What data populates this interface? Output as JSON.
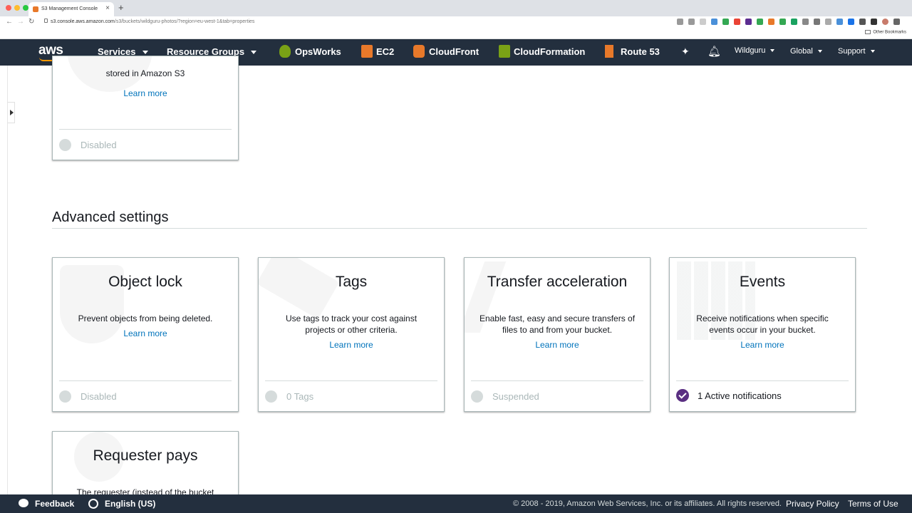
{
  "browser": {
    "tab_title": "S3 Management Console",
    "tab_close": "×",
    "new_tab": "+",
    "url_host": "s3.console.aws.amazon.com",
    "url_path": "/s3/buckets/wildguru-photos/?region=eu-west-1&tab=properties",
    "other_bookmarks": "Other Bookmarks"
  },
  "aws_nav": {
    "logo": "aws",
    "services": "Services",
    "resource_groups": "Resource Groups",
    "shortcuts": [
      "OpsWorks",
      "EC2",
      "CloudFront",
      "CloudFormation",
      "Route 53"
    ],
    "account": "Wildguru",
    "region": "Global",
    "support": "Support"
  },
  "top_card": {
    "desc_tail": "stored in Amazon S3",
    "learn_more": "Learn more",
    "status": "Disabled"
  },
  "advanced_settings": {
    "title": "Advanced settings",
    "cards": [
      {
        "title": "Object lock",
        "desc": "Prevent objects from being deleted.",
        "learn_more": "Learn more",
        "status": "Disabled"
      },
      {
        "title": "Tags",
        "desc": "Use tags to track your cost against projects or other criteria.",
        "learn_more": "Learn more",
        "status": "0 Tags"
      },
      {
        "title": "Transfer acceleration",
        "desc": "Enable fast, easy and secure transfers of files to and from your bucket.",
        "learn_more": "Learn more",
        "status": "Suspended"
      },
      {
        "title": "Events",
        "desc": "Receive notifications when specific events occur in your bucket.",
        "learn_more": "Learn more",
        "status": "1 Active notifications"
      },
      {
        "title": "Requester pays",
        "desc": "The requester (instead of the bucket"
      }
    ]
  },
  "footer": {
    "feedback": "Feedback",
    "language": "English (US)",
    "copyright": "© 2008 - 2019, Amazon Web Services, Inc. or its affiliates. All rights reserved.",
    "privacy": "Privacy Policy",
    "terms": "Terms of Use"
  },
  "colors": {
    "nav_bg": "#232f3e",
    "link": "#0073bb",
    "active_check": "#5a2f82",
    "aws_orange": "#ff9900"
  }
}
